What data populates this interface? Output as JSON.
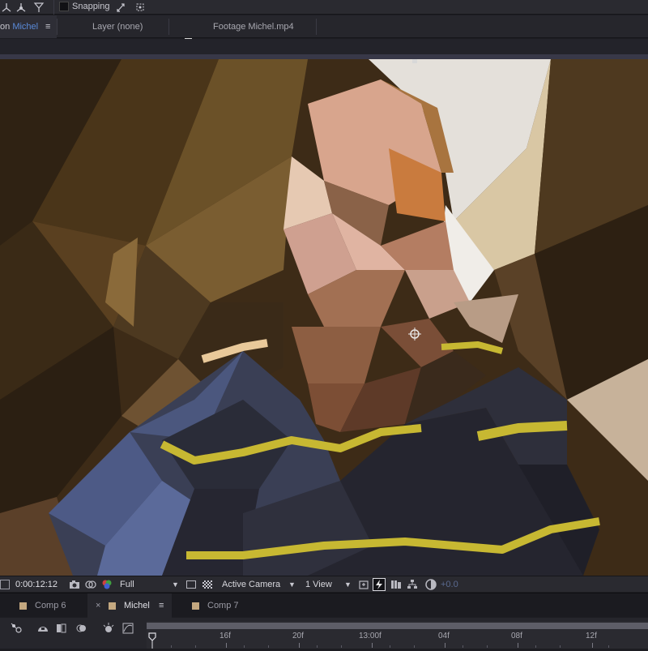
{
  "toolbar": {
    "snapping_label": "Snapping",
    "snapping_checked": false
  },
  "viewer_tabs": {
    "composition_tab_prefix": "on",
    "composition_tab_name": "Michel",
    "layer_tab": "Layer (none)",
    "footage_tab": "Footage Michel.mp4"
  },
  "viewer_controls": {
    "timecode": "0:00:12:12",
    "resolution": "Full",
    "camera": "Active Camera",
    "views": "1 View",
    "exposure": "+0.0"
  },
  "timeline_tabs": [
    {
      "label": "Comp 6",
      "active": false,
      "closable": false
    },
    {
      "label": "Michel",
      "active": true,
      "closable": true
    },
    {
      "label": "Comp 7",
      "active": false,
      "closable": false
    }
  ],
  "timeline_ruler": {
    "labels": [
      "16f",
      "20f",
      "13:00f",
      "04f",
      "08f",
      "12f"
    ]
  },
  "colors": {
    "accent_blue": "#5a8ad8",
    "panel_dark": "#1d1d22",
    "tab_swatch": "#c4a880"
  },
  "icons": {
    "toolbar": [
      "axis-world-icon",
      "axis-view-icon",
      "snapping-toggle-icon",
      "snap-edges-icon",
      "snap-features-icon"
    ],
    "viewer_controls": [
      "grid-guides-icon",
      "snapshot-camera-icon",
      "show-snapshot-icon",
      "color-channel-icon",
      "region-of-interest-icon",
      "transparency-grid-icon",
      "fast-previews-icon",
      "timeline-toggle-icon",
      "flowchart-icon",
      "exposure-reset-icon"
    ],
    "timeline": [
      "composition-mini-flowchart-icon",
      "draft-3d-icon",
      "frame-blending-icon",
      "motion-blur-icon",
      "graph-editor-icon",
      "current-time-indicator-icon"
    ]
  }
}
